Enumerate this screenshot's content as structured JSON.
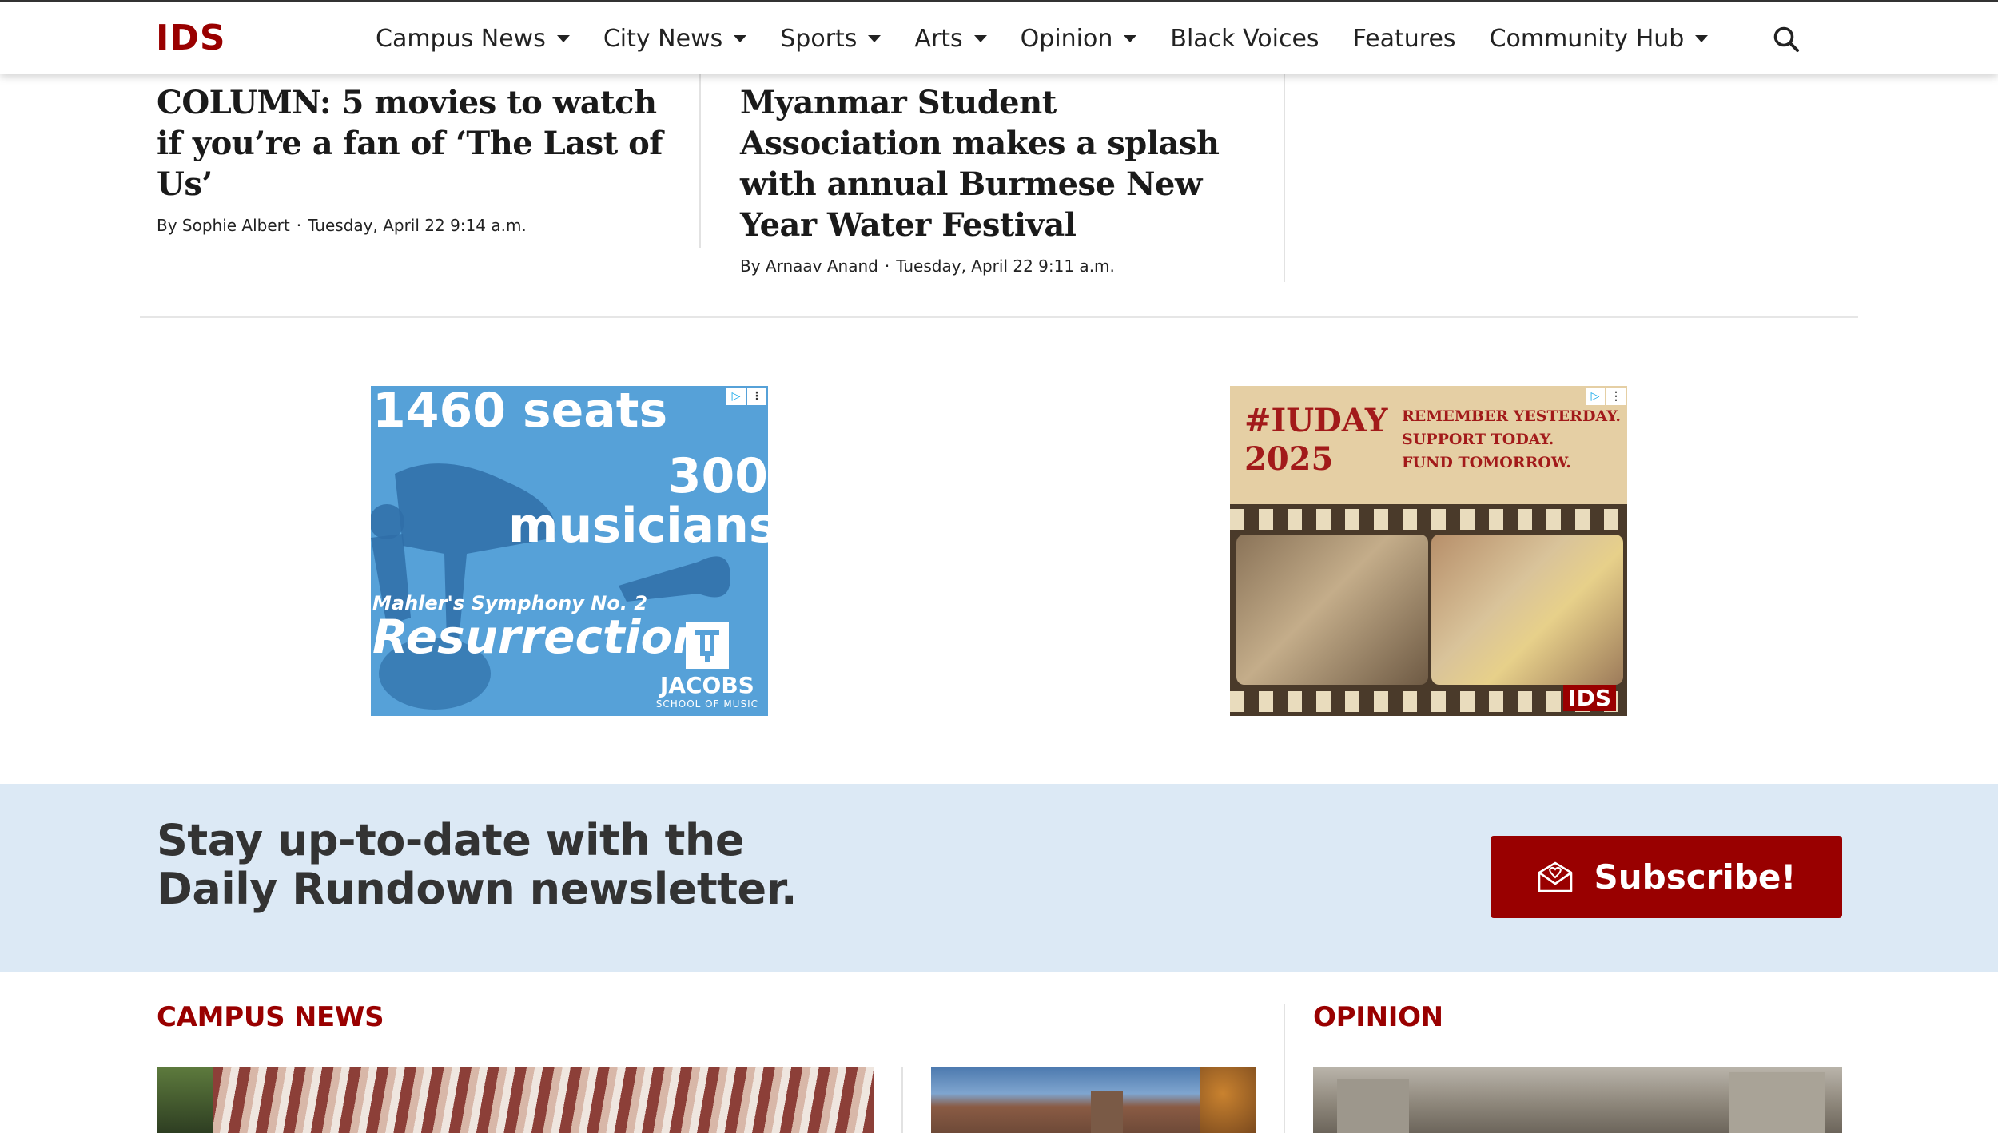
{
  "header": {
    "logo": "IDS",
    "nav": [
      {
        "label": "Campus News",
        "dropdown": true
      },
      {
        "label": "City News",
        "dropdown": true
      },
      {
        "label": "Sports",
        "dropdown": true
      },
      {
        "label": "Arts",
        "dropdown": true
      },
      {
        "label": "Opinion",
        "dropdown": true
      },
      {
        "label": "Black Voices",
        "dropdown": false
      },
      {
        "label": "Features",
        "dropdown": false
      },
      {
        "label": "Community Hub",
        "dropdown": true
      }
    ],
    "search_icon": "search-icon"
  },
  "stories": [
    {
      "title": "COLUMN: 5 movies to watch if you’re a fan of ‘The Last of Us’",
      "byline": "By Sophie Albert",
      "date": "Tuesday, April 22 9:14 a.m."
    },
    {
      "title": "Myanmar Student Association makes a splash with annual Burmese New Year Water Festival",
      "byline": "By Arnaav Anand",
      "date": "Tuesday, April 22 9:11 a.m."
    }
  ],
  "ads": {
    "ad1": {
      "line1": "1460 seats",
      "line2": "300",
      "line3": "musicians",
      "line4": "Mahler's Symphony No. 2",
      "line5": "Resurrection",
      "brand": "JACOBS",
      "brand_sub": "SCHOOL OF MUSIC"
    },
    "ad2": {
      "tag1": "#IUDAY",
      "tag2": "2025",
      "slogan1": "REMEMBER YESTERDAY.",
      "slogan2": "SUPPORT TODAY.",
      "slogan3": "FUND TOMORROW.",
      "logo": "IDS"
    }
  },
  "newsletter": {
    "line1": "Stay up-to-date with the",
    "line2": "Daily Rundown newsletter.",
    "button": "Subscribe!"
  },
  "sections": {
    "campus": "CAMPUS NEWS",
    "opinion": "OPINION"
  },
  "colors": {
    "brand_red": "#990000",
    "newsletter_bg": "#dce9f5",
    "ad_blue": "#56a1d8"
  }
}
